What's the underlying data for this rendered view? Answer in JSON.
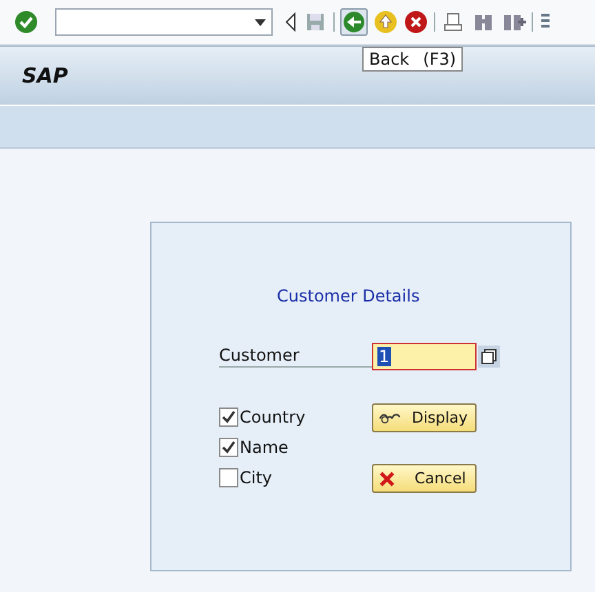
{
  "title": "SAP",
  "tooltip": {
    "label": "Back",
    "key": "(F3)"
  },
  "dialog": {
    "title": "Customer Details",
    "field": {
      "label": "Customer",
      "value": "1"
    },
    "checkboxes": [
      {
        "label": "Country",
        "checked": true
      },
      {
        "label": "Name",
        "checked": true
      },
      {
        "label": "City",
        "checked": false
      }
    ],
    "buttons": [
      {
        "label": "Display",
        "kind": "display"
      },
      {
        "label": "Cancel",
        "kind": "cancel"
      }
    ]
  }
}
